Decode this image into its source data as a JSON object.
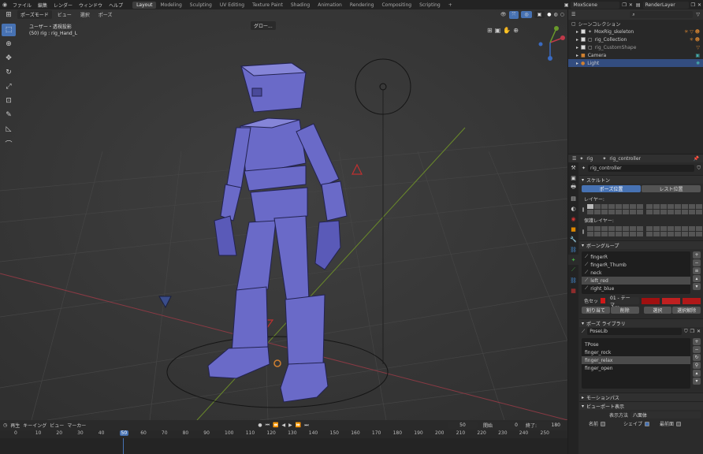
{
  "topbar": {
    "menus": [
      "ファイル",
      "編集",
      "レンダー",
      "ウィンドウ",
      "ヘルプ"
    ],
    "workspaces": [
      "Layout",
      "Modeling",
      "Sculpting",
      "UV Editing",
      "Texture Paint",
      "Shading",
      "Animation",
      "Rendering",
      "Compositing",
      "Scripting",
      "+"
    ],
    "active_workspace": "Layout",
    "scene": "MoxScene",
    "view_layer": "RenderLayer"
  },
  "viewport": {
    "mode": "ポーズモード",
    "menus": [
      "ビュー",
      "選択",
      "ポーズ"
    ],
    "view_name": "ユーザー・透視投影",
    "info": "(50) rig : rig_Hand_L",
    "transform_orientation": "グロー..."
  },
  "outliner": {
    "title": "シーンコレクション",
    "rows": [
      {
        "label": "MoxRig_skeleton",
        "sel": false
      },
      {
        "label": "rig_Collection",
        "sel": false
      },
      {
        "label": "rig_CustomShape",
        "sel": false
      },
      {
        "label": "Camera",
        "sel": false
      },
      {
        "label": "Light",
        "sel": true
      }
    ]
  },
  "properties": {
    "breadcrumb_a": "rig",
    "breadcrumb_b": "rig_controller",
    "data_name": "rig_controller",
    "skeleton": {
      "title": "スケルトン",
      "pose_position": "ポーズ位置",
      "rest_position": "レスト位置",
      "layers_label": "レイヤー:",
      "protected_layers_label": "保護レイヤー:"
    },
    "bone_groups": {
      "title": "ボーングループ",
      "items": [
        "fingerR",
        "fingerR_Thumb",
        "neck",
        "left_red",
        "right_blue"
      ],
      "selected": "left_red",
      "color_set_label": "色セッ",
      "color_set_value": "01 - テーマ...",
      "buttons": [
        "割り当て",
        "削除",
        "選択",
        "選択解除"
      ]
    },
    "pose_library": {
      "title": "ポーズ ライブラリ",
      "lib_name": "PoseLib",
      "items": [
        "TPose",
        "finger_rock",
        "finger_relax",
        "finger_open"
      ],
      "selected": "finger_relax"
    },
    "motion_paths": "モーションパス",
    "viewport_display": {
      "title": "ビューポート表示",
      "display_as_label": "表示方法",
      "display_as": "八面体",
      "name_label": "名前",
      "shape_label": "シェイプ",
      "front_label": "最前面"
    }
  },
  "timeline": {
    "menus": [
      "再生",
      "キーイング",
      "ビュー",
      "マーカー"
    ],
    "current_frame": "50",
    "start_label": "開始",
    "start": "0",
    "end_label": "終了:",
    "end": "180",
    "ticks": [
      "0",
      "10",
      "20",
      "30",
      "40",
      "50",
      "60",
      "70",
      "80",
      "90",
      "100",
      "110",
      "120",
      "130",
      "140",
      "150",
      "160",
      "170",
      "180",
      "190",
      "200",
      "210",
      "220",
      "230",
      "240",
      "250"
    ]
  }
}
